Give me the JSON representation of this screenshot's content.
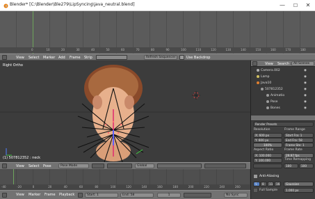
{
  "window": {
    "title": "Blender* [C:\\Blender\\Ble279\\LipSyncing\\java_neutral.blend]",
    "minimize": "—",
    "maximize": "☐",
    "close": "✕"
  },
  "sequencer": {
    "channel_label": "1",
    "ruler_ticks": [
      "0",
      "10",
      "20",
      "30",
      "40",
      "50",
      "60",
      "70",
      "80",
      "90",
      "100",
      "110",
      "120",
      "130",
      "140",
      "150",
      "160",
      "170",
      "180",
      "190"
    ],
    "menu": [
      "View",
      "Select",
      "Marker",
      "Add",
      "Frame",
      "Strip"
    ],
    "refresh_label": "Refresh Sequencer",
    "backdrop_label": "Use Backdrop"
  },
  "viewport": {
    "view_label": "Right Ortho",
    "object_label": "(1) 507812352 : neck",
    "menu": [
      "View",
      "Select",
      "Pose"
    ],
    "mode": "Pose Mode",
    "orientation": "Global"
  },
  "outliner": {
    "menu": [
      "View",
      "Search"
    ],
    "scene_filter": "All Scenes",
    "items": [
      {
        "label": "Camera.002",
        "color": "#b0b0b0",
        "indent": 8
      },
      {
        "label": "Lamp",
        "color": "#d0c060",
        "indent": 8
      },
      {
        "label": "Java10",
        "color": "#e08030",
        "indent": 8
      },
      {
        "label": "507812352",
        "color": "#9c9c9c",
        "indent": 14
      },
      {
        "label": "Animatio",
        "color": "#9c9c9c",
        "indent": 22
      },
      {
        "label": "Pose",
        "color": "#9c9c9c",
        "indent": 22
      },
      {
        "label": "Bones",
        "color": "#9c9c9c",
        "indent": 22
      }
    ]
  },
  "properties": {
    "section_preset": "Render Presets",
    "resolution_label": "Resolution",
    "res_x": "X: 600 px",
    "res_y": "Y: 600 px",
    "res_pct": "100%",
    "frame_range_label": "Frame Range",
    "start_frame": "Start Fra: 1",
    "end_frame": "End Fra: 58",
    "frame_step": "Frame Ste: 1",
    "aspect_label": "Aspect Ratio",
    "aspect_x": "X: 100.000",
    "aspect_y": "Y: 100.000",
    "frame_rate_label": "Frame Rate",
    "frame_rate": "29.97 fps",
    "time_remap_label": "Time Remapping",
    "time_old": "100",
    "time_new": "100",
    "aa_label": "Anti-Aliasing",
    "aa_samples": [
      "5",
      "8",
      "11",
      "16"
    ],
    "aa_filter": "Gaussian",
    "full_sample": "Full Sample",
    "filter_size": "1.000 px"
  },
  "timeline": {
    "menu": [
      "View",
      "Marker",
      "Frame",
      "Playback"
    ],
    "ruler_ticks": [
      "-40",
      "-20",
      "0",
      "20",
      "40",
      "60",
      "80",
      "100",
      "120",
      "140",
      "160",
      "180",
      "200",
      "220",
      "240",
      "260"
    ],
    "start": "Start:",
    "start_val": "1",
    "end": "End:",
    "end_val": "58",
    "current": "1",
    "sync": "No Sync"
  }
}
